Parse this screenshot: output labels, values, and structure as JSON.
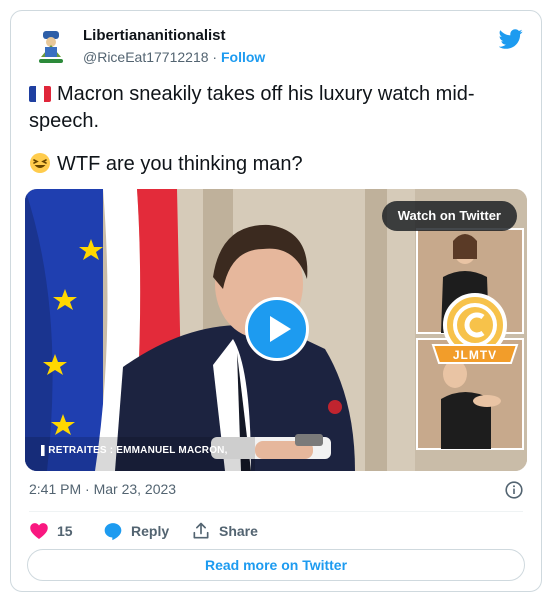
{
  "user": {
    "display_name": "Libertiananitionalist",
    "handle": "@RiceEat17712218",
    "separator": "·",
    "follow_label": "Follow"
  },
  "tweet": {
    "line1": "Macron sneakily takes off his luxury watch mid-speech.",
    "line2": "WTF are you thinking man?",
    "flag_emoji": "french-flag",
    "reaction_emoji": "laughing-face"
  },
  "media": {
    "watch_label": "Watch on Twitter",
    "caption": "▌RETRAITES : EMMANUEL MACRON, L'INTERVIEW",
    "logo_text": "JLMTV"
  },
  "timestamp": "2:41 PM · Mar 23, 2023",
  "actions": {
    "like_count": "15",
    "reply_label": "Reply",
    "share_label": "Share"
  },
  "read_more_label": "Read more on Twitter",
  "colors": {
    "accent": "#1d9bf0",
    "like": "#f91880",
    "text": "#0f1419",
    "muted": "#536471",
    "border": "#cfd9de"
  }
}
